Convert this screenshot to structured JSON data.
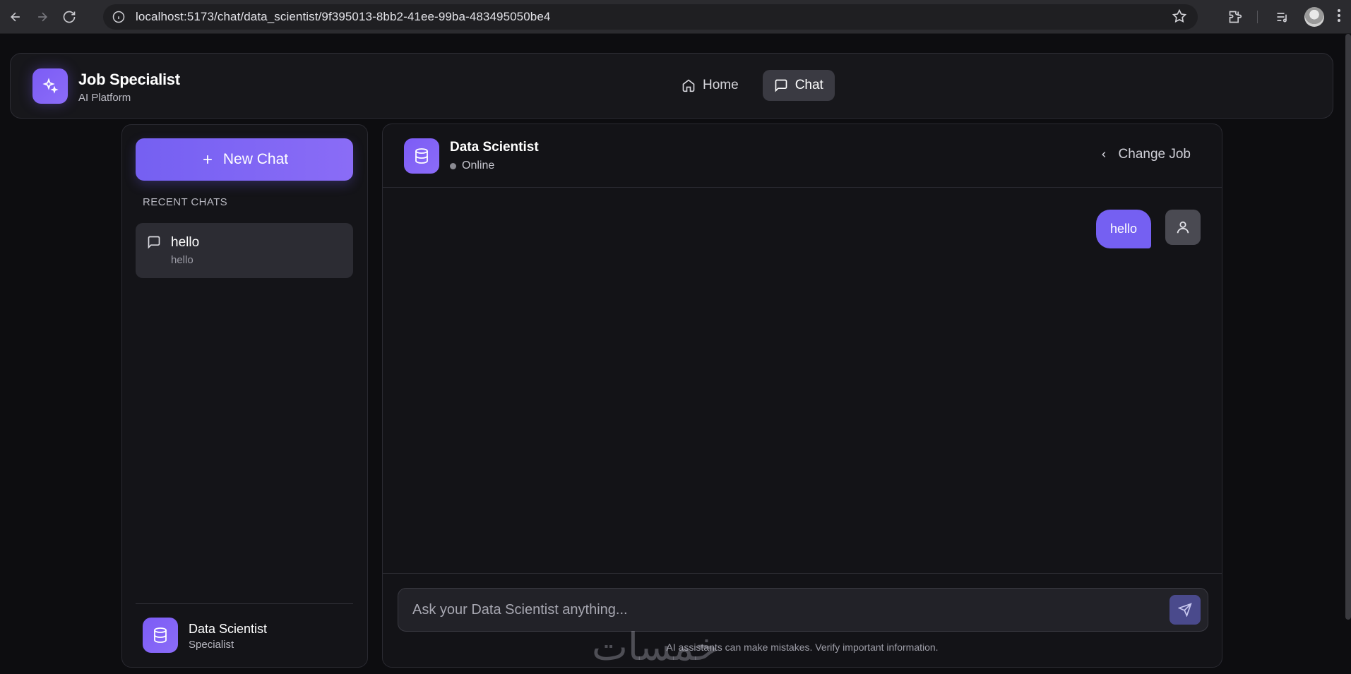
{
  "browser": {
    "url": "localhost:5173/chat/data_scientist/9f395013-8bb2-41ee-99ba-483495050be4"
  },
  "header": {
    "title": "Job Specialist",
    "subtitle": "AI Platform",
    "tabs": [
      {
        "label": "Home",
        "icon": "home-icon",
        "active": false
      },
      {
        "label": "Chat",
        "icon": "message-square-icon",
        "active": true
      }
    ]
  },
  "sidebar": {
    "new_chat_label": "New Chat",
    "recent_label": "RECENT CHATS",
    "chats": [
      {
        "title": "hello",
        "preview": "hello"
      }
    ],
    "profile": {
      "name": "Data Scientist",
      "role": "Specialist"
    }
  },
  "chat": {
    "job_title": "Data Scientist",
    "status": "Online",
    "change_job_label": "Change Job",
    "messages": [
      {
        "role": "user",
        "text": "hello"
      }
    ],
    "input_placeholder": "Ask your Data Scientist anything...",
    "disclaimer": "AI assistants can make mistakes. Verify important information."
  },
  "watermark": "خمسات",
  "colors": {
    "accent": "#7560f2",
    "background": "#0d0d10",
    "panel": "#131317"
  }
}
